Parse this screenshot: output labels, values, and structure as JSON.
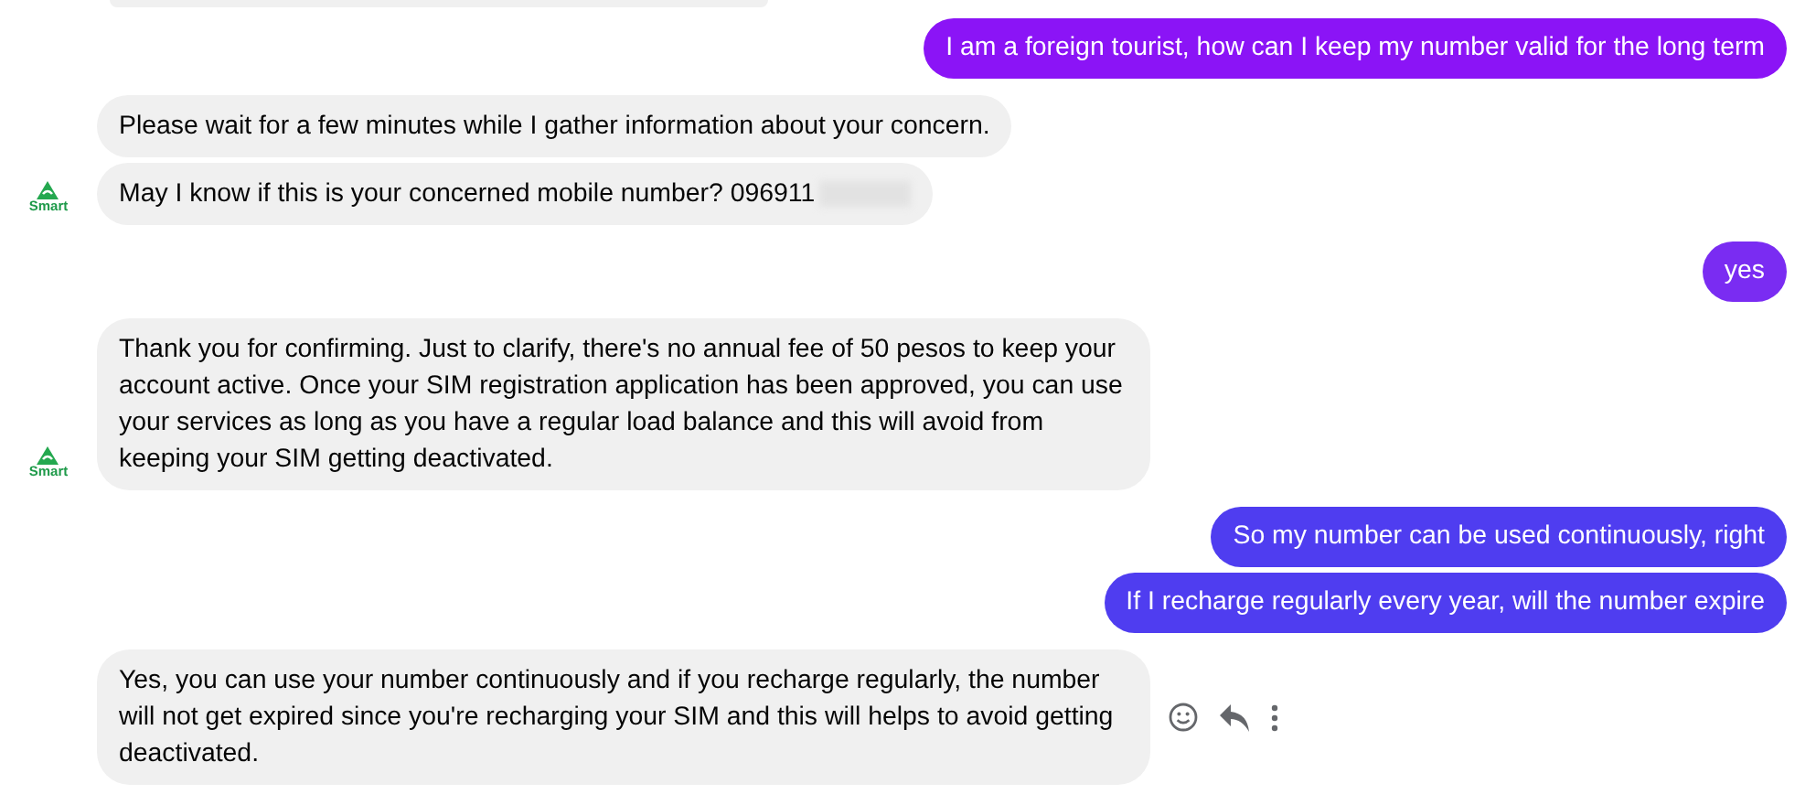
{
  "messages": [
    {
      "kind": "outgoing",
      "color": "#8b14f6",
      "bubbles": [
        "I am a foreign tourist, how can I keep my number valid for the long term"
      ]
    },
    {
      "kind": "incoming",
      "avatar": "Smart",
      "redacted_last": true,
      "bubbles": [
        "Please wait for a few minutes while I gather information about your concern.",
        "May I know if this is your concerned mobile number? 096911"
      ]
    },
    {
      "kind": "outgoing",
      "color": "#7a2cf2",
      "bubbles": [
        "yes"
      ]
    },
    {
      "kind": "incoming",
      "avatar": "Smart",
      "bubbles": [
        "Thank you for confirming. Just to clarify, there's no annual fee of 50 pesos to keep your account active. Once your SIM registration application has been approved, you can use your services as long as you have a regular load balance and this will avoid from keeping your SIM getting deactivated."
      ]
    },
    {
      "kind": "outgoing",
      "color": "#4f3df0",
      "bubbles": [
        "So my number can be used continuously, right",
        "If I recharge regularly every year, will the number expire"
      ]
    },
    {
      "kind": "incoming",
      "show_actions": true,
      "bubbles": [
        "Yes, you can use your number continuously and if you recharge regularly, the number will not get expired since you're recharging your SIM and this will helps to avoid getting deactivated."
      ]
    }
  ]
}
